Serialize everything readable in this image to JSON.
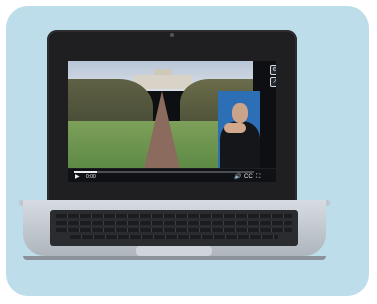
{
  "video": {
    "play_icon": "play-icon",
    "time_label": "0:00",
    "progress_fraction": 0.13
  },
  "colors": {
    "background_card": "#bcdde9",
    "laptop_lid": "#1f1f22",
    "screen": "#0e0f12",
    "signer_background": "#2d6fb4"
  }
}
